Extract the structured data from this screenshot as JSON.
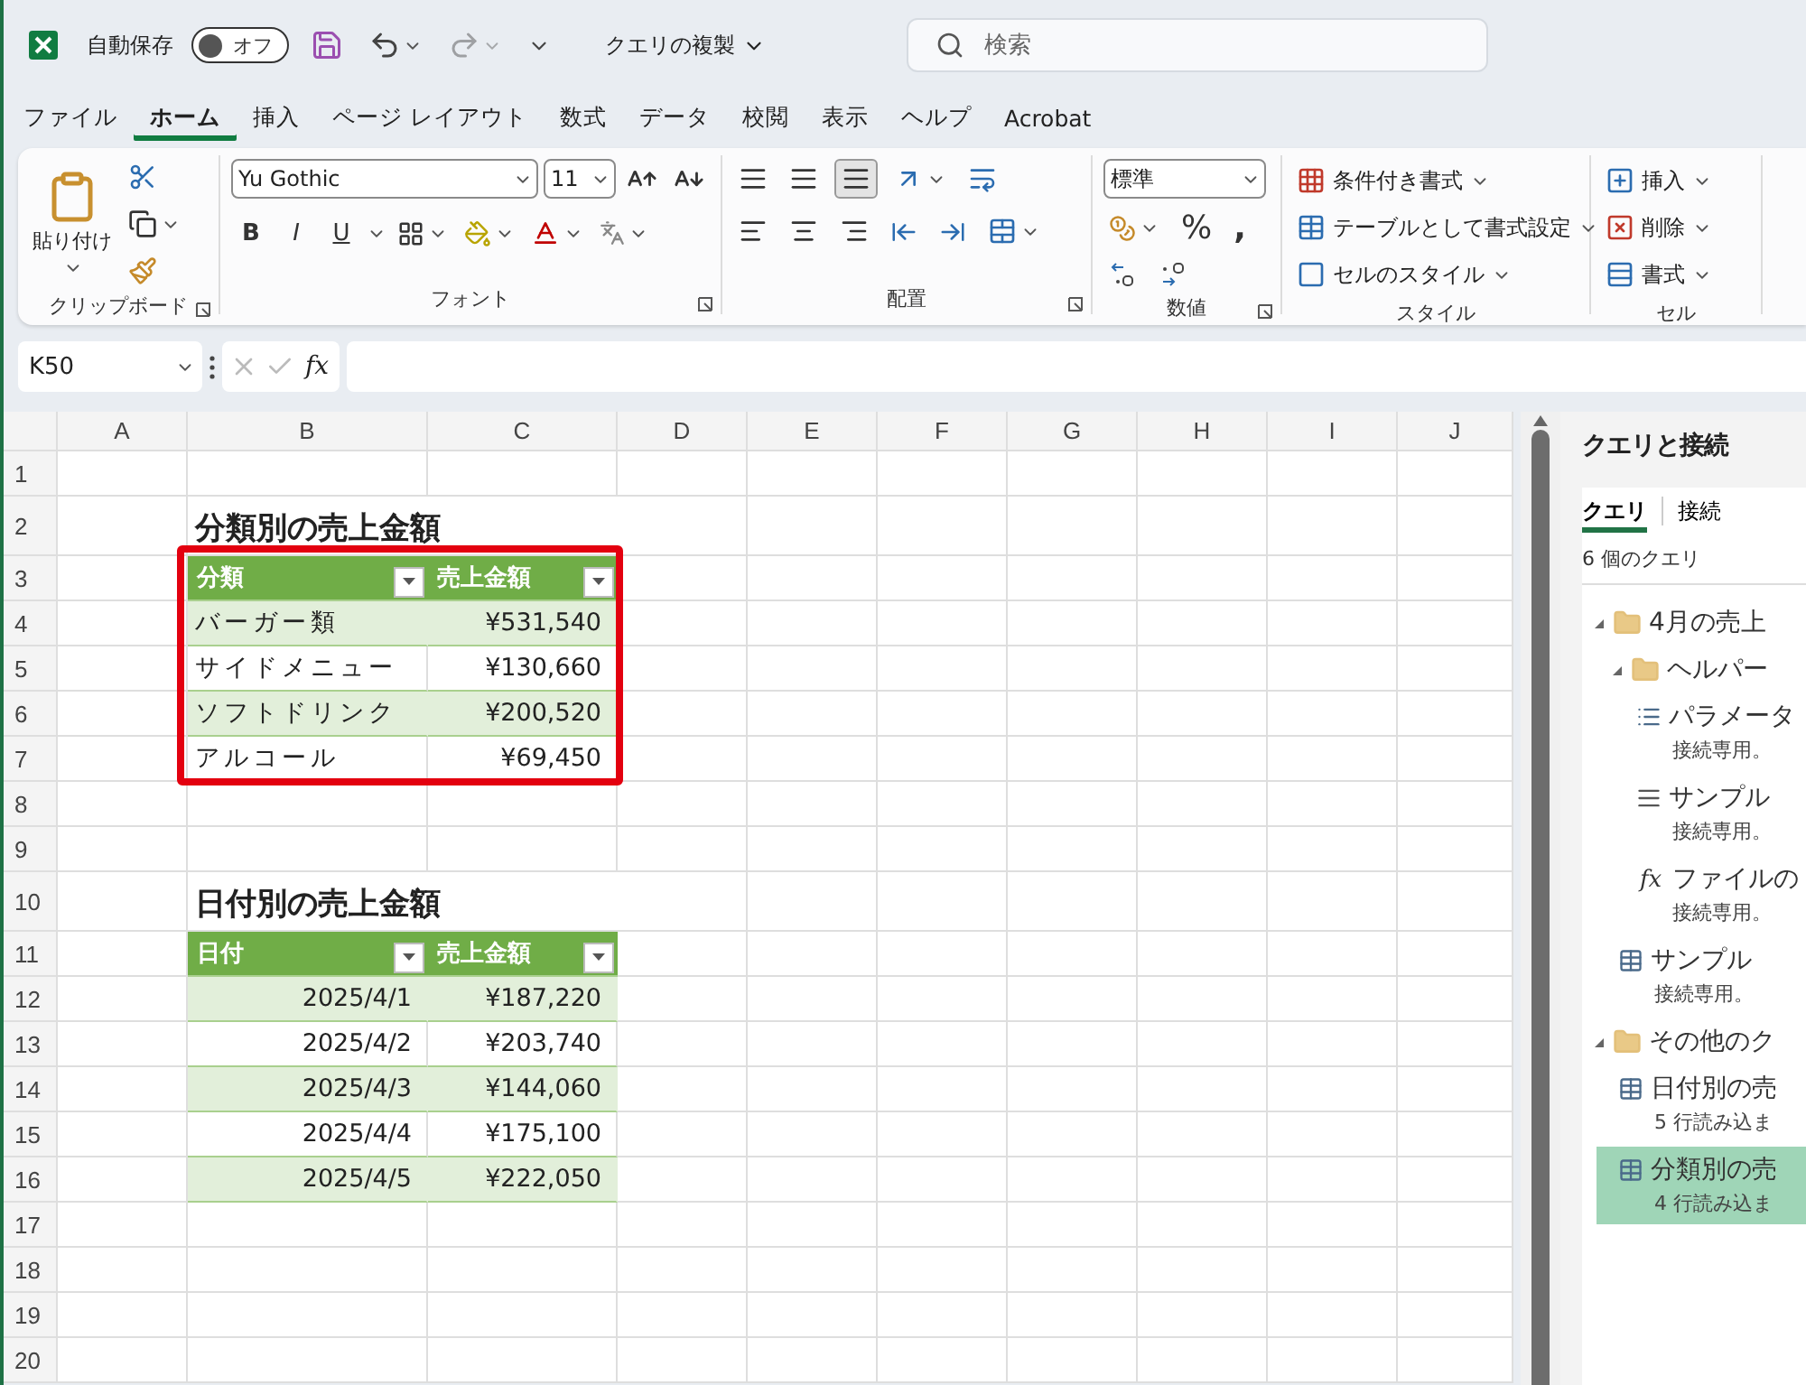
{
  "title_bar": {
    "autosave": {
      "label": "自動保存",
      "on": false,
      "state_label": "オフ"
    },
    "document_title": "クエリの複製",
    "search": {
      "placeholder": "検索"
    }
  },
  "menu_tabs": [
    {
      "label": "ファイル",
      "selected": false
    },
    {
      "label": "ホーム",
      "selected": true
    },
    {
      "label": "挿入",
      "selected": false
    },
    {
      "label": "ページ レイアウト",
      "selected": false
    },
    {
      "label": "数式",
      "selected": false
    },
    {
      "label": "データ",
      "selected": false
    },
    {
      "label": "校閲",
      "selected": false
    },
    {
      "label": "表示",
      "selected": false
    },
    {
      "label": "ヘルプ",
      "selected": false
    },
    {
      "label": "Acrobat",
      "selected": false
    }
  ],
  "ribbon": [
    {
      "kind": "clipboard",
      "label": "クリップボード",
      "launcher": true,
      "paste": "貼り付け"
    },
    {
      "kind": "font",
      "label": "フォント",
      "launcher": true,
      "font_name": "Yu Gothic",
      "font_size": "11",
      "styles": [
        "B",
        "I",
        "U"
      ]
    },
    {
      "kind": "alignment",
      "label": "配置",
      "launcher": true
    },
    {
      "kind": "number",
      "label": "数値",
      "launcher": true,
      "format": "標準",
      "percent": "%",
      "comma": ","
    },
    {
      "kind": "styles",
      "label": "スタイル",
      "launcher": false,
      "commands": [
        "条件付き書式",
        "テーブルとして書式設定",
        "セルのスタイル"
      ]
    },
    {
      "kind": "cells",
      "label": "セル",
      "launcher": false,
      "commands": [
        "挿入",
        "削除",
        "書式"
      ]
    }
  ],
  "formula_bar": {
    "name_box": "K50",
    "function_label": "fx"
  },
  "sheet": {
    "columns": [
      "A",
      "B",
      "C",
      "D",
      "E",
      "F",
      "G",
      "H",
      "I",
      "J"
    ],
    "rows": [
      {
        "number": "1",
        "kind": "empty"
      },
      {
        "number": "2",
        "kind": "title",
        "text": "分類別の売上金額"
      },
      {
        "number": "3",
        "kind": "table_header",
        "highlighted": true,
        "cells": [
          "分類",
          "売上金額"
        ]
      },
      {
        "number": "4",
        "kind": "table_row",
        "highlighted": true,
        "banded": true,
        "cells": [
          {
            "text": "バーガー類",
            "kind": "text"
          },
          {
            "text": "¥531,540",
            "kind": "number"
          }
        ]
      },
      {
        "number": "5",
        "kind": "table_row",
        "highlighted": true,
        "banded": false,
        "cells": [
          {
            "text": "サイドメニュー",
            "kind": "text"
          },
          {
            "text": "¥130,660",
            "kind": "number"
          }
        ]
      },
      {
        "number": "6",
        "kind": "table_row",
        "highlighted": true,
        "banded": true,
        "cells": [
          {
            "text": "ソフトドリンク",
            "kind": "text"
          },
          {
            "text": "¥200,520",
            "kind": "number"
          }
        ]
      },
      {
        "number": "7",
        "kind": "table_row",
        "highlighted": true,
        "banded": false,
        "cells": [
          {
            "text": "アルコール",
            "kind": "text"
          },
          {
            "text": "¥69,450",
            "kind": "number"
          }
        ]
      },
      {
        "number": "8",
        "kind": "empty"
      },
      {
        "number": "9",
        "kind": "empty"
      },
      {
        "number": "10",
        "kind": "title",
        "text": "日付別の売上金額"
      },
      {
        "number": "11",
        "kind": "table_header",
        "highlighted": false,
        "cells": [
          "日付",
          "売上金額"
        ]
      },
      {
        "number": "12",
        "kind": "table_row",
        "highlighted": false,
        "banded": true,
        "cells": [
          {
            "text": "2025/4/1",
            "kind": "date"
          },
          {
            "text": "¥187,220",
            "kind": "number"
          }
        ]
      },
      {
        "number": "13",
        "kind": "table_row",
        "highlighted": false,
        "banded": false,
        "cells": [
          {
            "text": "2025/4/2",
            "kind": "date"
          },
          {
            "text": "¥203,740",
            "kind": "number"
          }
        ]
      },
      {
        "number": "14",
        "kind": "table_row",
        "highlighted": false,
        "banded": true,
        "cells": [
          {
            "text": "2025/4/3",
            "kind": "date"
          },
          {
            "text": "¥144,060",
            "kind": "number"
          }
        ]
      },
      {
        "number": "15",
        "kind": "table_row",
        "highlighted": false,
        "banded": false,
        "cells": [
          {
            "text": "2025/4/4",
            "kind": "date"
          },
          {
            "text": "¥175,100",
            "kind": "number"
          }
        ]
      },
      {
        "number": "16",
        "kind": "table_row",
        "highlighted": false,
        "banded": true,
        "cells": [
          {
            "text": "2025/4/5",
            "kind": "date"
          },
          {
            "text": "¥222,050",
            "kind": "number"
          }
        ]
      },
      {
        "number": "17",
        "kind": "empty"
      },
      {
        "number": "18",
        "kind": "empty"
      },
      {
        "number": "19",
        "kind": "empty"
      },
      {
        "number": "20",
        "kind": "empty"
      }
    ]
  },
  "query_pane": {
    "title": "クエリと接続",
    "tabs": [
      {
        "label": "クエリ",
        "selected": true
      },
      {
        "label": "接続",
        "selected": false
      }
    ],
    "count": "6 個のクエリ",
    "tree": [
      {
        "kind": "folder",
        "label": "4月の売上",
        "expanded": true,
        "children": [
          {
            "kind": "folder",
            "label": "ヘルパー",
            "expanded": true,
            "children": [
              {
                "kind": "parameter",
                "label": "パラメータ",
                "status": "接続専用。",
                "selected": false
              },
              {
                "kind": "list",
                "label": "サンプル",
                "status": "接続専用。",
                "selected": false
              },
              {
                "kind": "function",
                "icon_label": "fx",
                "label": "ファイルの",
                "status": "接続専用。",
                "selected": false
              }
            ]
          },
          {
            "kind": "table",
            "label": "サンプル",
            "status": "接続専用。",
            "selected": false
          }
        ]
      },
      {
        "kind": "folder",
        "label": "その他のク",
        "expanded": true,
        "children": [
          {
            "kind": "table",
            "label": "日付別の売",
            "status": "5 行読み込ま",
            "selected": false
          },
          {
            "kind": "table",
            "label": "分類別の売",
            "status": "4 行読み込ま",
            "selected": true
          }
        ]
      }
    ]
  }
}
